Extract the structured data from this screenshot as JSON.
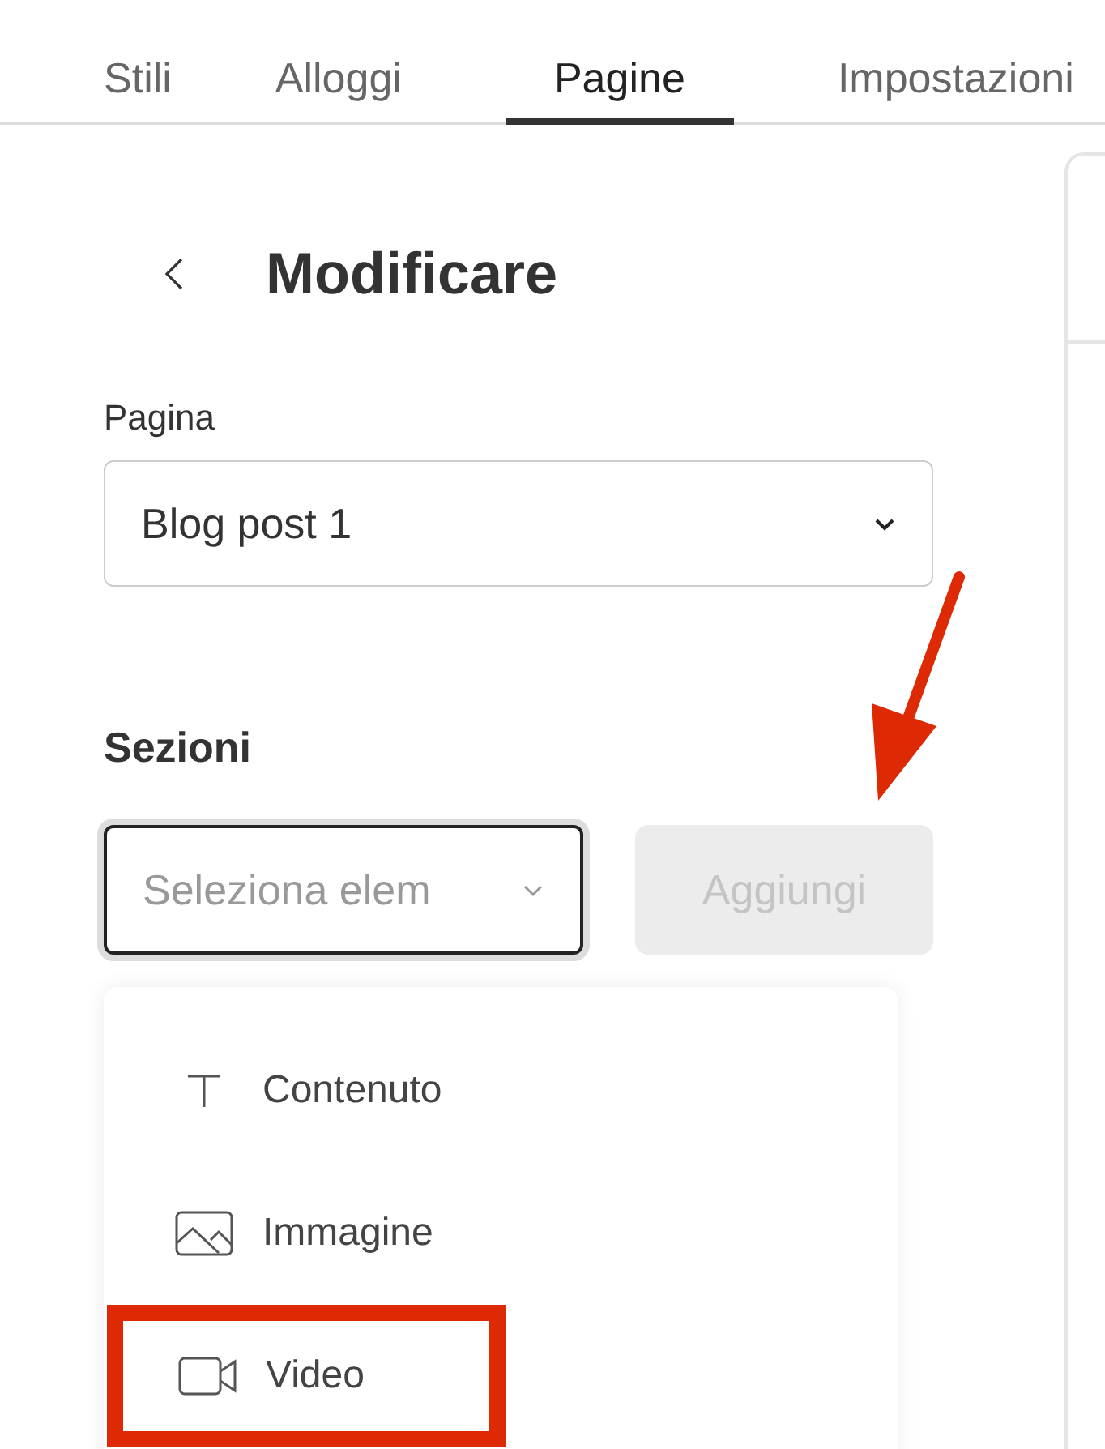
{
  "tabs": [
    {
      "label": "Stili",
      "selected": false
    },
    {
      "label": "Alloggi",
      "selected": false
    },
    {
      "label": "Pagine",
      "selected": true
    },
    {
      "label": "Impostazioni",
      "selected": false
    }
  ],
  "panel": {
    "title": "Modificare",
    "page_label": "Pagina",
    "page_select": {
      "value": "Blog post 1"
    },
    "sections_heading": "Sezioni",
    "section_select": {
      "placeholder": "Seleziona elem",
      "focused": true
    },
    "add_button": {
      "label": "Aggiungi",
      "disabled": true
    },
    "menu": [
      {
        "kind": "text",
        "label": "Contenuto",
        "annotated": false
      },
      {
        "kind": "image",
        "label": "Immagine",
        "annotated": false
      },
      {
        "kind": "video",
        "label": "Video",
        "annotated": true
      }
    ]
  },
  "annotation_arrow": true
}
